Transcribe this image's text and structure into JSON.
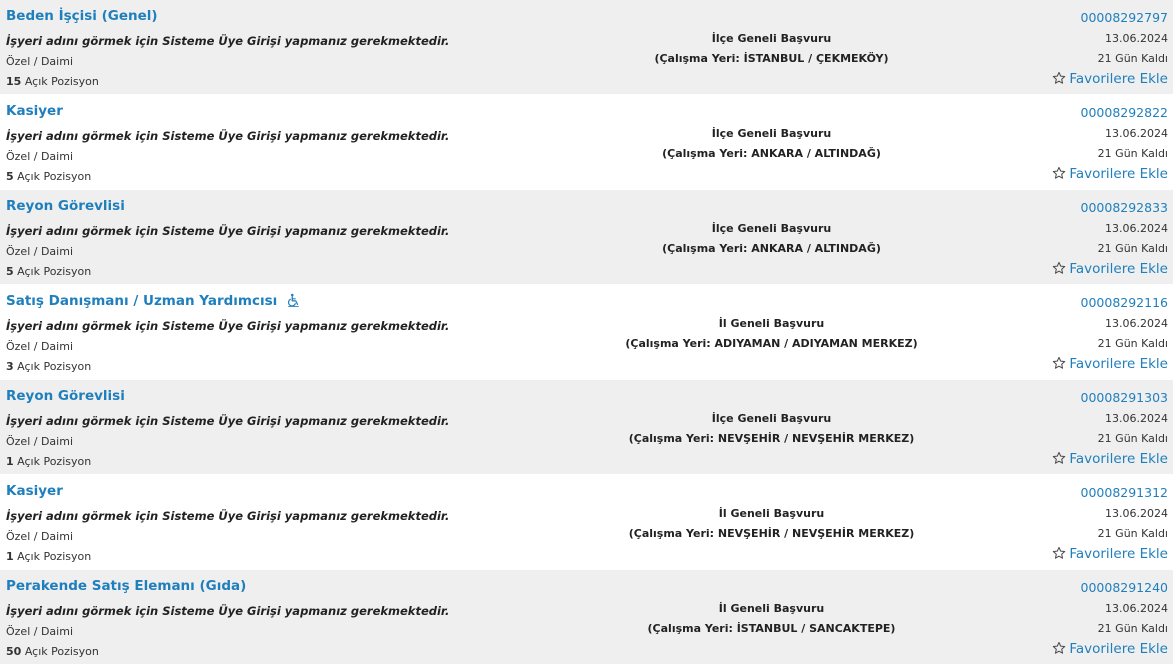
{
  "listings": [
    {
      "title": "Beden İşçisi (Genel)",
      "notice": "İşyeri adını görmek için Sisteme Üye Girişi yapmanız gerekmektedir.",
      "employment": "Özel / Daimi",
      "positions_count": "15",
      "positions_label": "Açık Pozisyon",
      "scope": "İlçe Geneli Başvuru",
      "location": "(Çalışma Yeri: İSTANBUL / ÇEKMEKÖY)",
      "id": "00008292797",
      "date": "13.06.2024",
      "remaining": "21 Gün Kaldı",
      "favorite_label": "Favorilere Ekle",
      "accessible": false
    },
    {
      "title": "Kasiyer",
      "notice": "İşyeri adını görmek için Sisteme Üye Girişi yapmanız gerekmektedir.",
      "employment": "Özel / Daimi",
      "positions_count": "5",
      "positions_label": "Açık Pozisyon",
      "scope": "İlçe Geneli Başvuru",
      "location": "(Çalışma Yeri: ANKARA / ALTINDAĞ)",
      "id": "00008292822",
      "date": "13.06.2024",
      "remaining": "21 Gün Kaldı",
      "favorite_label": "Favorilere Ekle",
      "accessible": false
    },
    {
      "title": "Reyon Görevlisi",
      "notice": "İşyeri adını görmek için Sisteme Üye Girişi yapmanız gerekmektedir.",
      "employment": "Özel / Daimi",
      "positions_count": "5",
      "positions_label": "Açık Pozisyon",
      "scope": "İlçe Geneli Başvuru",
      "location": "(Çalışma Yeri: ANKARA / ALTINDAĞ)",
      "id": "00008292833",
      "date": "13.06.2024",
      "remaining": "21 Gün Kaldı",
      "favorite_label": "Favorilere Ekle",
      "accessible": false
    },
    {
      "title": "Satış Danışmanı / Uzman Yardımcısı",
      "notice": "İşyeri adını görmek için Sisteme Üye Girişi yapmanız gerekmektedir.",
      "employment": "Özel / Daimi",
      "positions_count": "3",
      "positions_label": "Açık Pozisyon",
      "scope": "İl Geneli Başvuru",
      "location": "(Çalışma Yeri: ADIYAMAN / ADIYAMAN MERKEZ)",
      "id": "00008292116",
      "date": "13.06.2024",
      "remaining": "21 Gün Kaldı",
      "favorite_label": "Favorilere Ekle",
      "accessible": true
    },
    {
      "title": "Reyon Görevlisi",
      "notice": "İşyeri adını görmek için Sisteme Üye Girişi yapmanız gerekmektedir.",
      "employment": "Özel / Daimi",
      "positions_count": "1",
      "positions_label": "Açık Pozisyon",
      "scope": "İlçe Geneli Başvuru",
      "location": "(Çalışma Yeri: NEVŞEHİR / NEVŞEHİR MERKEZ)",
      "id": "00008291303",
      "date": "13.06.2024",
      "remaining": "21 Gün Kaldı",
      "favorite_label": "Favorilere Ekle",
      "accessible": false
    },
    {
      "title": "Kasiyer",
      "notice": "İşyeri adını görmek için Sisteme Üye Girişi yapmanız gerekmektedir.",
      "employment": "Özel / Daimi",
      "positions_count": "1",
      "positions_label": "Açık Pozisyon",
      "scope": "İl Geneli Başvuru",
      "location": "(Çalışma Yeri: NEVŞEHİR / NEVŞEHİR MERKEZ)",
      "id": "00008291312",
      "date": "13.06.2024",
      "remaining": "21 Gün Kaldı",
      "favorite_label": "Favorilere Ekle",
      "accessible": false
    },
    {
      "title": "Perakende Satış Elemanı (Gıda)",
      "notice": "İşyeri adını görmek için Sisteme Üye Girişi yapmanız gerekmektedir.",
      "employment": "Özel / Daimi",
      "positions_count": "50",
      "positions_label": "Açık Pozisyon",
      "scope": "İl Geneli Başvuru",
      "location": "(Çalışma Yeri: İSTANBUL / SANCAKTEPE)",
      "id": "00008291240",
      "date": "13.06.2024",
      "remaining": "21 Gün Kaldı",
      "favorite_label": "Favorilere Ekle",
      "accessible": false
    }
  ],
  "icons": {
    "favorite": "star-outline-icon",
    "accessible": "wheelchair-icon"
  },
  "colors": {
    "link": "#1f7fbd",
    "row_alt": "#efefef"
  }
}
